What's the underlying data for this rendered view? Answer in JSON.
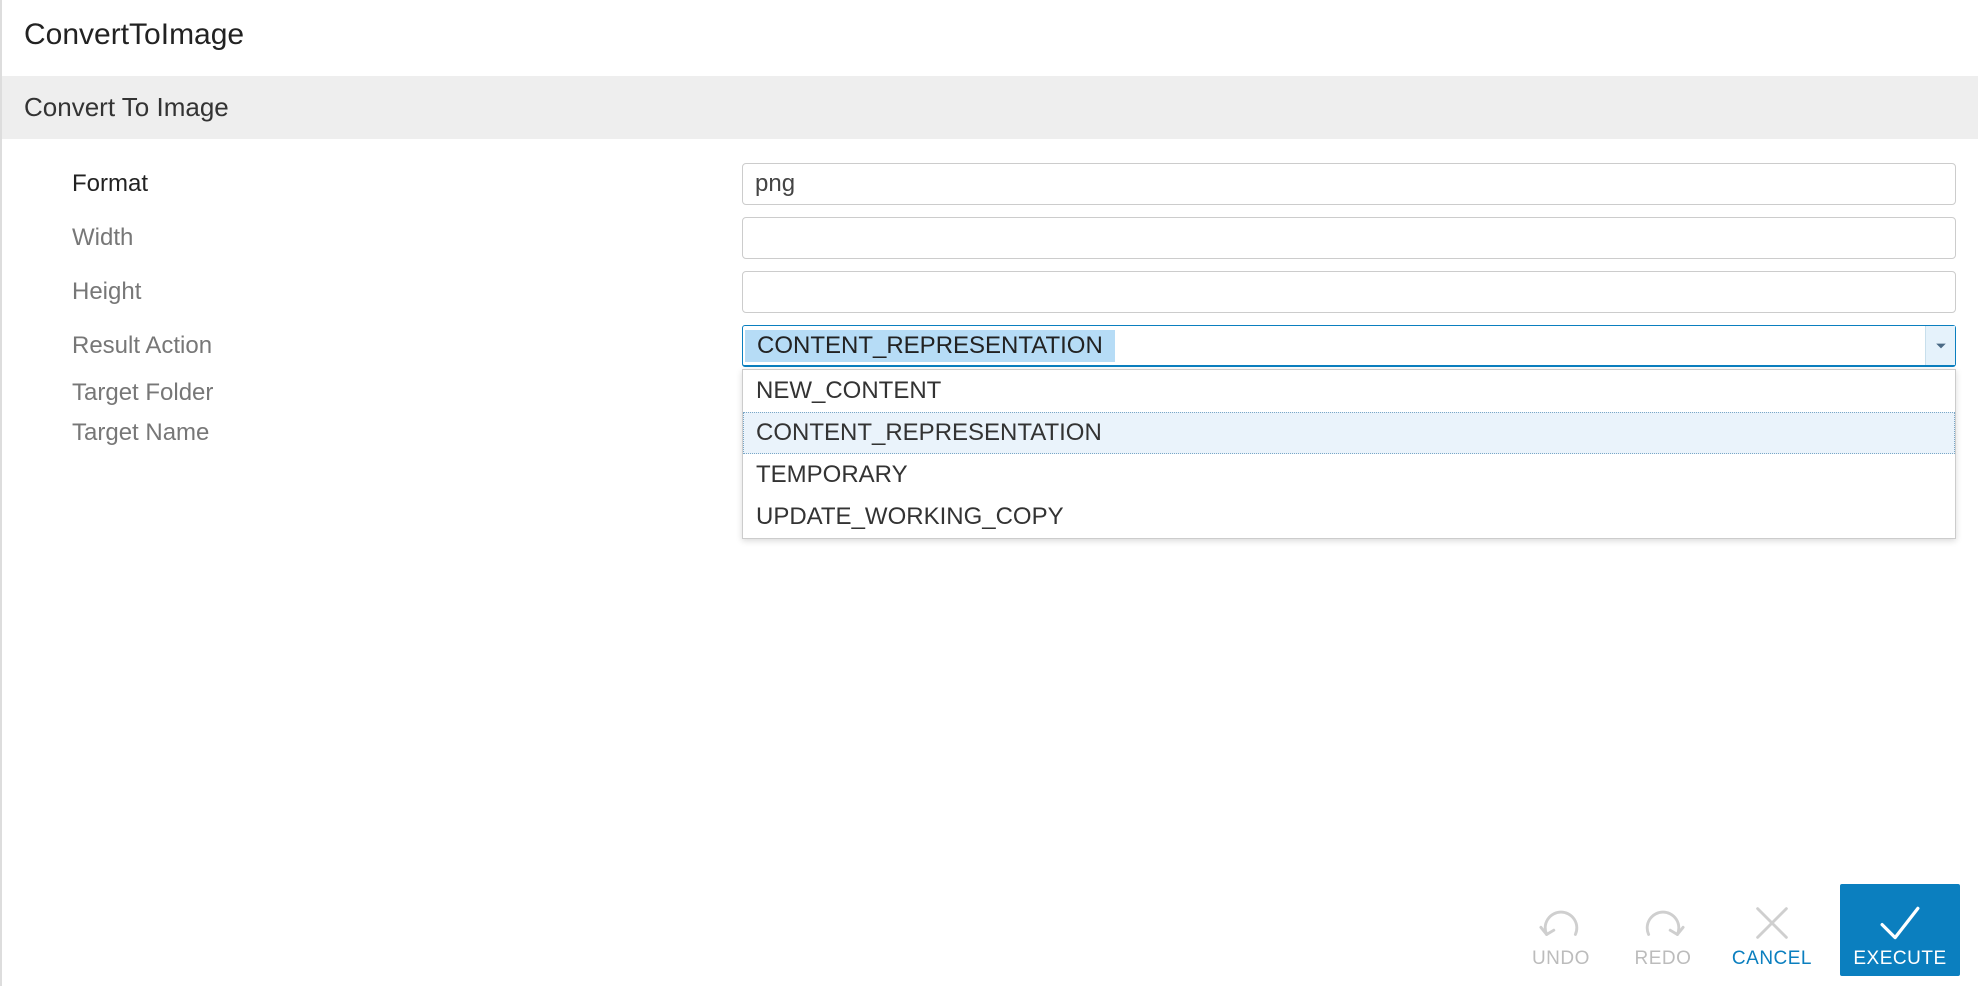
{
  "title": "ConvertToImage",
  "section_title": "Convert To Image",
  "fields": {
    "format": {
      "label": "Format",
      "value": "png"
    },
    "width": {
      "label": "Width",
      "value": ""
    },
    "height": {
      "label": "Height",
      "value": ""
    },
    "result_action": {
      "label": "Result Action",
      "value": "CONTENT_REPRESENTATION",
      "options": [
        "NEW_CONTENT",
        "CONTENT_REPRESENTATION",
        "TEMPORARY",
        "UPDATE_WORKING_COPY"
      ]
    },
    "target_folder": {
      "label": "Target Folder",
      "value": ""
    },
    "target_name": {
      "label": "Target Name",
      "value": ""
    }
  },
  "footer": {
    "undo": "UNDO",
    "redo": "REDO",
    "cancel": "CANCEL",
    "execute": "EXECUTE"
  }
}
